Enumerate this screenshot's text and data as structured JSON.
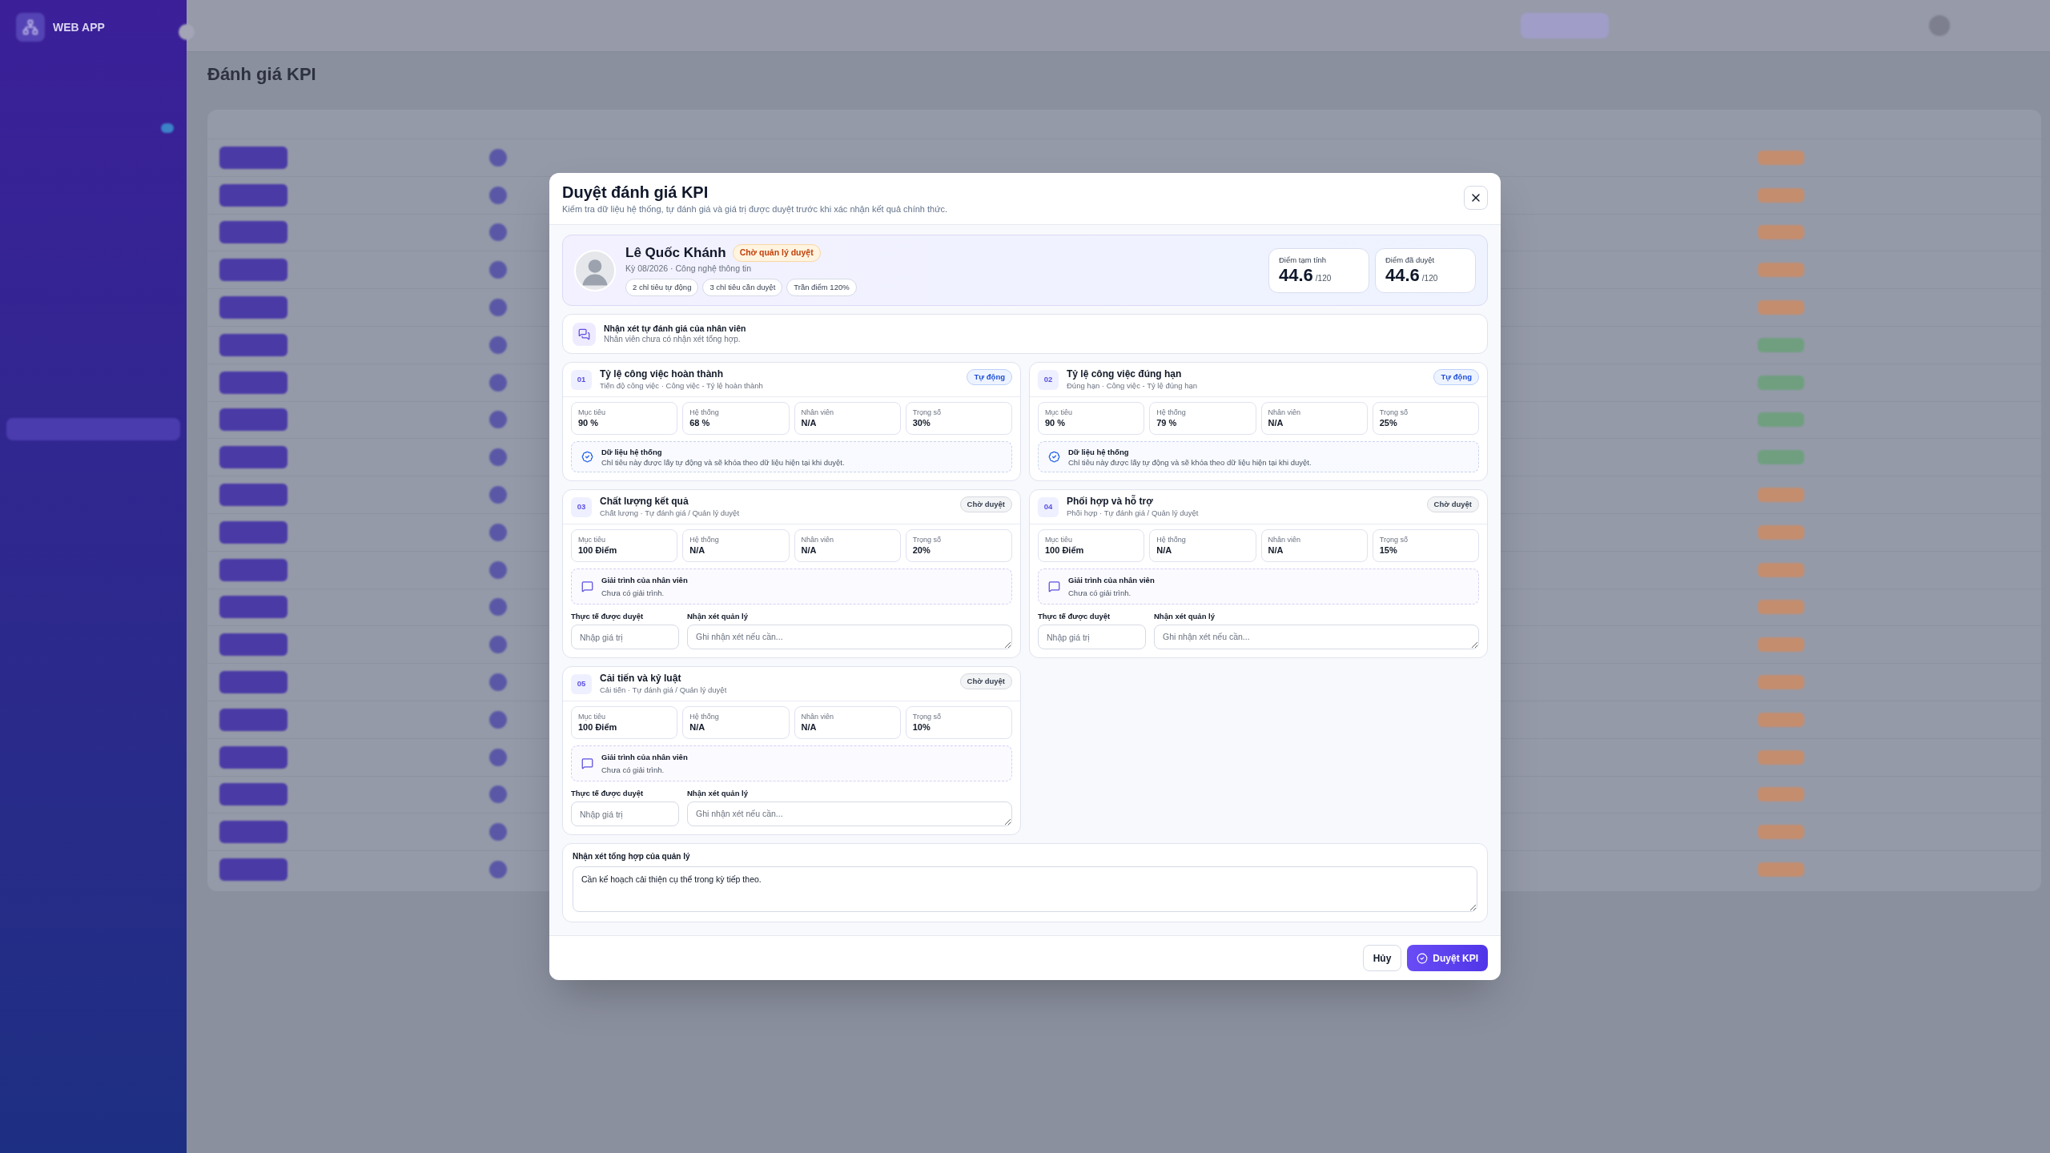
{
  "backdrop": {
    "app_name": "WEB APP",
    "page_title": "Đánh giá KPI",
    "rows": [
      {
        "color": "#c48d6e"
      },
      {
        "color": "#c48d6e"
      },
      {
        "color": "#c48d6e"
      },
      {
        "color": "#c48d6e"
      },
      {
        "color": "#c48d6e"
      },
      {
        "color": "#6f9f7f"
      },
      {
        "color": "#6f9f7f"
      },
      {
        "color": "#6f9f7f"
      },
      {
        "color": "#6f9f7f"
      },
      {
        "color": "#c48d6e"
      },
      {
        "color": "#c48d6e"
      },
      {
        "color": "#c48d6e"
      },
      {
        "color": "#c48d6e"
      },
      {
        "color": "#c48d6e"
      },
      {
        "color": "#c48d6e"
      },
      {
        "color": "#c48d6e"
      },
      {
        "color": "#c48d6e"
      },
      {
        "color": "#c48d6e"
      },
      {
        "color": "#c48d6e"
      },
      {
        "color": "#c48d6e"
      }
    ]
  },
  "modal": {
    "title": "Duyệt đánh giá KPI",
    "subtitle": "Kiểm tra dữ liệu hệ thống, tự đánh giá và giá trị được duyệt trước khi xác nhận kết quả chính thức."
  },
  "employee": {
    "name": "Lê Quốc Khánh",
    "status": "Chờ quản lý duyệt",
    "meta": "Kỳ 08/2026 · Công nghệ thông tin",
    "chips": [
      "2 chỉ tiêu tự động",
      "3 chỉ tiêu cần duyệt",
      "Trần điểm 120%"
    ],
    "scores": [
      {
        "label": "Điểm tạm tính",
        "value": "44.6",
        "max": "/120"
      },
      {
        "label": "Điểm đã duyệt",
        "value": "44.6",
        "max": "/120"
      }
    ]
  },
  "self_review": {
    "title": "Nhận xét tự đánh giá của nhân viên",
    "text": "Nhân viên chưa có nhận xét tổng hợp."
  },
  "kpis": [
    {
      "number": "01",
      "title": "Tỷ lệ công việc hoàn thành",
      "source": "Tiến độ công việc · Công việc - Tỷ lệ hoàn thành",
      "kind": "auto",
      "badge": "Tự động",
      "stats": [
        {
          "label": "Mục tiêu",
          "value": "90 %"
        },
        {
          "label": "Hệ thống",
          "value": "68 %"
        },
        {
          "label": "Nhân viên",
          "value": "N/A"
        },
        {
          "label": "Trọng số",
          "value": "30%"
        }
      ],
      "note": {
        "title": "Dữ liệu hệ thống",
        "text": "Chỉ tiêu này được lấy tự động và sẽ khóa theo dữ liệu hiện tại khi duyệt."
      }
    },
    {
      "number": "02",
      "title": "Tỷ lệ công việc đúng hạn",
      "source": "Đúng hạn · Công việc - Tỷ lệ đúng hạn",
      "kind": "auto",
      "badge": "Tự động",
      "stats": [
        {
          "label": "Mục tiêu",
          "value": "90 %"
        },
        {
          "label": "Hệ thống",
          "value": "79 %"
        },
        {
          "label": "Nhân viên",
          "value": "N/A"
        },
        {
          "label": "Trọng số",
          "value": "25%"
        }
      ],
      "note": {
        "title": "Dữ liệu hệ thống",
        "text": "Chỉ tiêu này được lấy tự động và sẽ khóa theo dữ liệu hiện tại khi duyệt."
      }
    },
    {
      "number": "03",
      "title": "Chất lượng kết quả",
      "source": "Chất lượng · Tự đánh giá / Quản lý duyệt",
      "kind": "manual",
      "badge": "Chờ duyệt",
      "stats": [
        {
          "label": "Mục tiêu",
          "value": "100 Điểm"
        },
        {
          "label": "Hệ thống",
          "value": "N/A"
        },
        {
          "label": "Nhân viên",
          "value": "N/A"
        },
        {
          "label": "Trọng số",
          "value": "20%"
        }
      ],
      "note": {
        "title": "Giải trình của nhân viên",
        "text": "Chưa có giải trình."
      },
      "approved": {
        "label": "Thực tế được duyệt",
        "placeholder": "Nhập giá trị"
      },
      "comment": {
        "label": "Nhận xét quản lý",
        "placeholder": "Ghi nhận xét nếu cần..."
      }
    },
    {
      "number": "04",
      "title": "Phối hợp và hỗ trợ",
      "source": "Phối hợp · Tự đánh giá / Quản lý duyệt",
      "kind": "manual",
      "badge": "Chờ duyệt",
      "stats": [
        {
          "label": "Mục tiêu",
          "value": "100 Điểm"
        },
        {
          "label": "Hệ thống",
          "value": "N/A"
        },
        {
          "label": "Nhân viên",
          "value": "N/A"
        },
        {
          "label": "Trọng số",
          "value": "15%"
        }
      ],
      "note": {
        "title": "Giải trình của nhân viên",
        "text": "Chưa có giải trình."
      },
      "approved": {
        "label": "Thực tế được duyệt",
        "placeholder": "Nhập giá trị"
      },
      "comment": {
        "label": "Nhận xét quản lý",
        "placeholder": "Ghi nhận xét nếu cần..."
      }
    },
    {
      "number": "05",
      "title": "Cải tiến và kỷ luật",
      "source": "Cải tiến · Tự đánh giá / Quản lý duyệt",
      "kind": "manual",
      "badge": "Chờ duyệt",
      "stats": [
        {
          "label": "Mục tiêu",
          "value": "100 Điểm"
        },
        {
          "label": "Hệ thống",
          "value": "N/A"
        },
        {
          "label": "Nhân viên",
          "value": "N/A"
        },
        {
          "label": "Trọng số",
          "value": "10%"
        }
      ],
      "note": {
        "title": "Giải trình của nhân viên",
        "text": "Chưa có giải trình."
      },
      "approved": {
        "label": "Thực tế được duyệt",
        "placeholder": "Nhập giá trị"
      },
      "comment": {
        "label": "Nhận xét quản lý",
        "placeholder": "Ghi nhận xét nếu cần..."
      }
    }
  ],
  "summary": {
    "label": "Nhận xét tổng hợp của quản lý",
    "value": "Cần kế hoạch cải thiện cụ thể trong kỳ tiếp theo."
  },
  "buttons": [
    {
      "label": "Hủy",
      "kind": "secondary"
    },
    {
      "label": "Duyệt KPI",
      "kind": "primary"
    }
  ]
}
